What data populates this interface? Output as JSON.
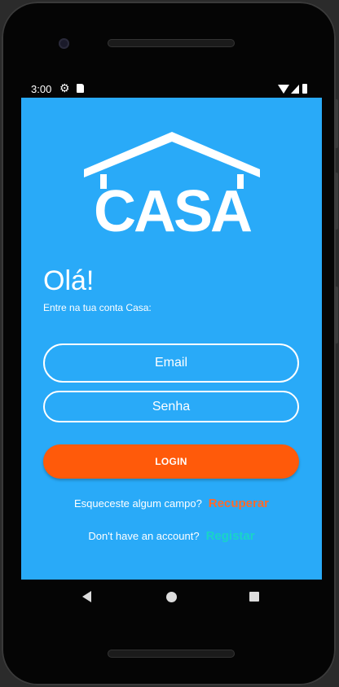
{
  "status_bar": {
    "time": "3:00",
    "icons": [
      "gear-icon",
      "sd-card-icon",
      "wifi-icon",
      "signal-icon",
      "battery-icon"
    ]
  },
  "logo": {
    "text": "CASA"
  },
  "greeting": "Olá!",
  "subtitle": "Entre na tua conta Casa:",
  "form": {
    "email_placeholder": "Email",
    "password_placeholder": "Senha",
    "login_label": "LOGIN"
  },
  "recover": {
    "prompt": "Esqueceste algum campo?",
    "link": "Recuperar"
  },
  "register": {
    "prompt": "Don't have an account?",
    "link": "Registar"
  },
  "navigation": [
    "back-icon",
    "home-icon",
    "recents-icon"
  ],
  "colors": {
    "screen_bg": "#29aaf8",
    "login_button": "#ff5a0a",
    "recover_link": "#ff6a2a",
    "register_link": "#19d4c8"
  }
}
